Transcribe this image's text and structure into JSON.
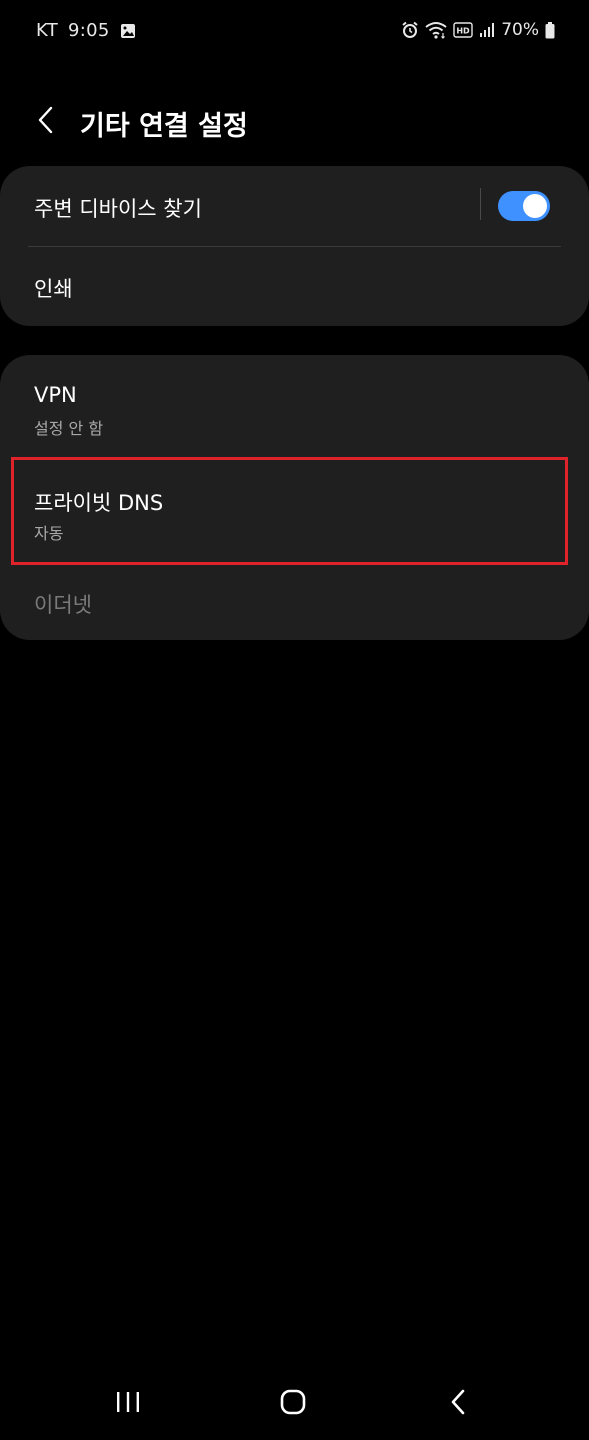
{
  "status_bar": {
    "carrier": "KT",
    "time": "9:05",
    "battery": "70%",
    "icons": [
      "gallery-icon",
      "alarm-icon",
      "wifi-icon",
      "hd-icon",
      "signal-icon",
      "battery-icon"
    ]
  },
  "header": {
    "title": "기타 연결 설정",
    "back_icon": "chevron-left-icon"
  },
  "card1": {
    "nearby": {
      "title": "주변 디바이스 찾기",
      "toggle_on": true
    },
    "print": {
      "title": "인쇄"
    }
  },
  "card2": {
    "vpn": {
      "title": "VPN",
      "subtitle": "설정 안 함"
    },
    "private_dns": {
      "title": "프라이빗 DNS",
      "subtitle": "자동"
    },
    "ethernet": {
      "title": "이더넷",
      "enabled": false
    }
  },
  "colors": {
    "background": "#000000",
    "card": "#1f1f1f",
    "accent": "#3e91ff",
    "highlight": "#e0232b",
    "subtitle": "#a8a8a8",
    "disabled": "#7a7a7a"
  },
  "nav_bar": {
    "icons": [
      "recents-icon",
      "home-icon",
      "back-icon"
    ]
  }
}
